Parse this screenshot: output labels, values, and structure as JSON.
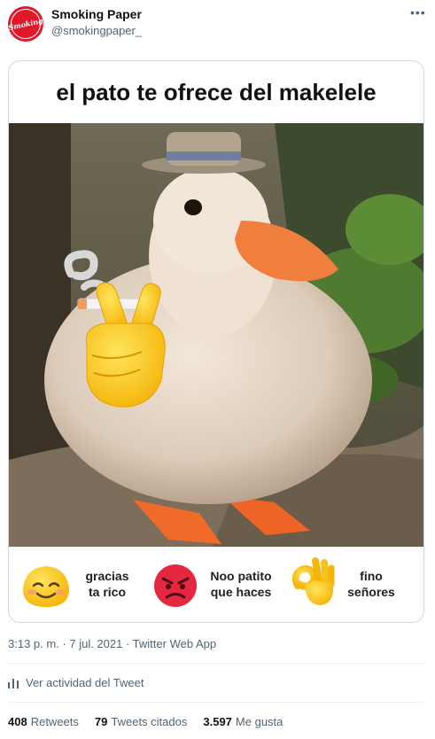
{
  "tweet": {
    "author_name": "Smoking Paper",
    "author_handle": "@smokingpaper_",
    "avatar_text": "Smoking",
    "more_label": "•••",
    "timestamp": "3:13 p. m. · 7 jul. 2021 · Twitter Web App",
    "activity_label": "Ver actividad del Tweet",
    "stats": {
      "retweets_count": "408",
      "retweets_label": "Retweets",
      "quotes_count": "79",
      "quotes_label": "Tweets citados",
      "likes_count": "3.597",
      "likes_label": "Me gusta"
    }
  },
  "meme": {
    "caption": "el pato te ofrece del makelele",
    "reactions": [
      {
        "icon": "smiling-face-icon",
        "line1": "gracias",
        "line2": "ta rico"
      },
      {
        "icon": "angry-face-icon",
        "line1": "Noo patito",
        "line2": "que haces"
      },
      {
        "icon": "ok-hand-icon",
        "line1": "fino",
        "line2": "señores"
      }
    ]
  },
  "colors": {
    "brand": "#e0182a",
    "muted_text": "#536471",
    "border": "#cfd9de"
  }
}
